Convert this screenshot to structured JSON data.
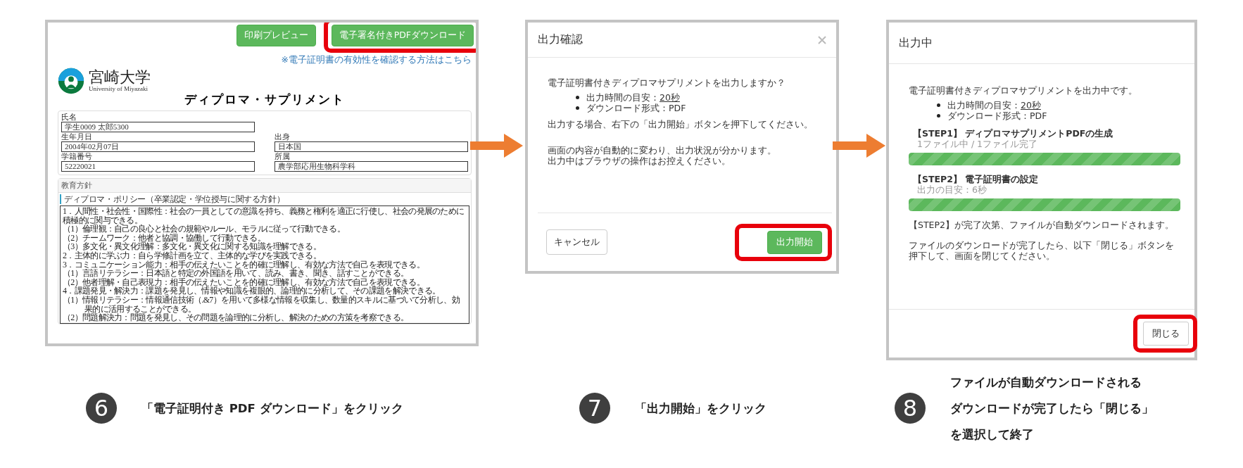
{
  "diploma_page": {
    "buttons": [
      {
        "label": "印刷プレビュー",
        "highlighted": false
      },
      {
        "label": "電子署名付きPDFダウンロード",
        "highlighted": true
      }
    ],
    "link": "※電子証明書の有効性を確認する方法はこちら",
    "logo": {
      "name": "宮崎大学",
      "subtitle": "University of Miyazaki"
    },
    "title": "ディプロマ・サプリメント",
    "field_rows": [
      [
        {
          "label": "氏名",
          "value": "学生0009 太郎5300"
        }
      ],
      [
        {
          "label": "生年月日",
          "value": "2004年02月07日"
        },
        {
          "label": "出身",
          "value": "日本国"
        }
      ],
      [
        {
          "label": "学籍番号",
          "value": "52220021"
        },
        {
          "label": "所属",
          "value": "農学部応用生物科学科"
        }
      ]
    ],
    "section": {
      "title": "教育方針",
      "subtitle": "ディプロマ・ポリシー（卒業認定・学位授与に関する方針）",
      "items": [
        {
          "kind": "main",
          "text": "1．人間性・社会性・国際性：社会の一員としての意識を持ち、義務と権利を適正に行使し、社会の発展のために積極的に関与できる。"
        },
        {
          "kind": "sub",
          "text": "（1）倫理観：自己の良心と社会の規範やルール、モラルに従って行動できる。"
        },
        {
          "kind": "sub",
          "text": "（2）チームワーク：他者と協調・協働して行動できる。"
        },
        {
          "kind": "sub",
          "text": "（3）多文化・異文化理解：多文化・異文化に関する知識を理解できる。"
        },
        {
          "kind": "main",
          "text": "2．主体的に学ぶ力：自ら学修計画を立て、主体的な学びを実践できる。"
        },
        {
          "kind": "main",
          "text": "3．コミュニケーション能力：相手の伝えたいことを的確に理解し、有効な方法で自己を表現できる。"
        },
        {
          "kind": "sub",
          "text": "（1）言語リテラシー：日本語と特定の外国語を用いて、読み、書き、聞き、話すことができる。"
        },
        {
          "kind": "sub",
          "text": "（2）他者理解・自己表現力：相手の伝えたいことを的確に理解し、有効な方法で自己を表現できる。"
        },
        {
          "kind": "main",
          "text": "4．課題発見・解決力：課題を発見し、情報や知識を複眼的、論理的に分析して、その課題を解決できる。"
        },
        {
          "kind": "sub",
          "text": "（1）情報リテラシー：情報通信技術（.&7）を用いて多様な情報を収集し、数量的スキルに基づいて分析し、効果的に活用することができる。"
        },
        {
          "kind": "sub",
          "text": "（2）問題解決力：問題を発見し、その問題を論理的に分析し、解決のための方策を考察できる。"
        }
      ]
    }
  },
  "confirm_dialog": {
    "title": "出力確認",
    "question": "電子証明書付きディプロマサプリメントを出力しますか？",
    "bullets": [
      {
        "text": "出力時間の目安：",
        "link": "20秒"
      },
      {
        "text": "ダウンロード形式：PDF"
      }
    ],
    "paragraphs": [
      [
        "出力する場合、右下の「出力開始」ボタンを押下してください。"
      ],
      [
        "画面の内容が自動的に変わり、出力状況が分かります。",
        "出力中はブラウザの操作はお控えください。"
      ]
    ],
    "buttons": [
      {
        "label": "キャンセル",
        "kind": "default",
        "highlighted": false
      },
      {
        "label": "出力開始",
        "kind": "primary",
        "highlighted": true
      }
    ]
  },
  "progress_dialog": {
    "title": "出力中",
    "intro": "電子証明書付きディプロマサプリメントを出力中です。",
    "bullets": [
      {
        "text": "出力時間の目安：",
        "link": "20秒"
      },
      {
        "text": "ダウンロード形式：PDF"
      }
    ],
    "steps": [
      {
        "title": "【STEP1】 ディプロマサプリメントPDFの生成",
        "detail": "1ファイル中 / 1ファイル完了",
        "level": 1
      },
      {
        "title": "【STEP2】 電子証明書の設定",
        "detail": "出力の目安：6秒",
        "level": 1
      }
    ],
    "paragraphs": [
      "【STEP2】が完了次第、ファイルが自動ダウンロードされます。",
      "ファイルのダウンロードが完了したら、以下「閉じる」ボタンを押下して、画面を閉じてください。"
    ],
    "buttons": [
      {
        "label": "閉じる",
        "kind": "default",
        "highlighted": true
      }
    ]
  },
  "captions": [
    {
      "number": "6",
      "lines": [
        "「電子証明付き PDF ダウンロード」をクリック"
      ]
    },
    {
      "number": "7",
      "lines": [
        "「出力開始」をクリック"
      ]
    },
    {
      "number": "8",
      "lines": [
        "ファイルが自動ダウンロードされる",
        "ダウンロードが完了したら「閉じる」",
        "を選択して終了"
      ]
    }
  ]
}
